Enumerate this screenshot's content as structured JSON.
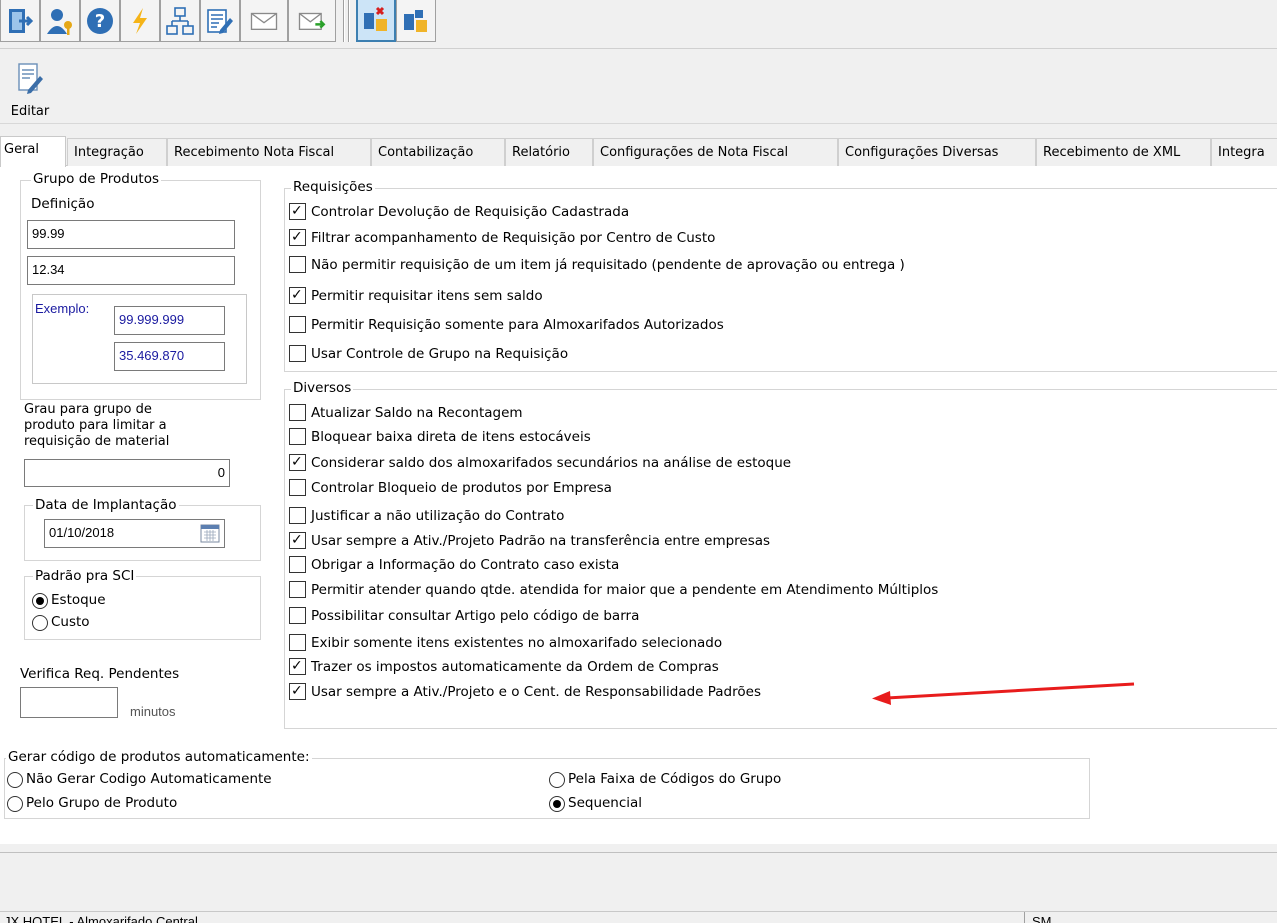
{
  "toolbar": {
    "icons": [
      "exit-icon",
      "user-key-icon",
      "help-icon",
      "lightning-icon",
      "org-chart-icon",
      "form-edit-icon",
      "mail-icon",
      "mail-send-icon",
      "module-close-icon",
      "module-icon"
    ]
  },
  "actions": {
    "edit_label": "Editar"
  },
  "tabs": [
    {
      "label": "Geral"
    },
    {
      "label": "Integração"
    },
    {
      "label": "Recebimento Nota Fiscal"
    },
    {
      "label": "Contabilização"
    },
    {
      "label": "Relatório"
    },
    {
      "label": "Configurações de Nota Fiscal"
    },
    {
      "label": "Configurações Diversas"
    },
    {
      "label": "Recebimento de XML"
    },
    {
      "label": "Integra"
    }
  ],
  "grupo_produtos": {
    "title": "Grupo de Produtos",
    "definicao_label": "Definição",
    "def1": "99.99",
    "def2": "12.34",
    "exemplo_label": "Exemplo:",
    "ex1": "99.999.999",
    "ex2": "35.469.870"
  },
  "grau": {
    "label_line1": "Grau para grupo de",
    "label_line2": "produto para limitar a",
    "label_line3": "requisição de material",
    "value": "0"
  },
  "data_implantacao": {
    "title": "Data de Implantação",
    "value": "01/10/2018"
  },
  "padrao_sci": {
    "title": "Padrão pra SCI",
    "options": [
      {
        "label": "Estoque",
        "selected": true
      },
      {
        "label": "Custo",
        "selected": false
      }
    ]
  },
  "verifica": {
    "label": "Verifica Req. Pendentes",
    "value": "",
    "unit": "minutos"
  },
  "requisicoes": {
    "title": "Requisições",
    "items": [
      {
        "label": "Controlar Devolução de Requisição Cadastrada",
        "checked": true
      },
      {
        "label": "Filtrar acompanhamento de Requisição por Centro de Custo",
        "checked": true
      },
      {
        "label": "Não permitir requisição de um item já requisitado (pendente de aprovação ou entrega )",
        "checked": false
      },
      {
        "label": "Permitir requisitar itens sem saldo",
        "checked": true
      },
      {
        "label": "Permitir Requisição somente para Almoxarifados Autorizados",
        "checked": false
      },
      {
        "label": "Usar Controle de Grupo na Requisição",
        "checked": false
      }
    ]
  },
  "diversos": {
    "title": "Diversos",
    "items": [
      {
        "label": "Atualizar Saldo na Recontagem",
        "checked": false
      },
      {
        "label": "Bloquear baixa direta de itens estocáveis",
        "checked": false
      },
      {
        "label": "Considerar saldo dos almoxarifados secundários na análise de estoque",
        "checked": true
      },
      {
        "label": "Controlar Bloqueio de produtos por Empresa",
        "checked": false
      },
      {
        "label": "Justificar a não utilização do Contrato",
        "checked": false
      },
      {
        "label": "Usar sempre a Ativ./Projeto Padrão na transferência entre empresas",
        "checked": true
      },
      {
        "label": "Obrigar a Informação do Contrato caso exista",
        "checked": false
      },
      {
        "label": "Permitir atender quando qtde. atendida for maior que a pendente em Atendimento Múltiplos",
        "checked": false
      },
      {
        "label": "Possibilitar consultar Artigo pelo código de barra",
        "checked": false
      },
      {
        "label": "Exibir somente itens existentes no almoxarifado selecionado",
        "checked": false
      },
      {
        "label": "Trazer os impostos automaticamente da Ordem de Compras",
        "checked": true
      },
      {
        "label": "Usar sempre a Ativ./Projeto e o Cent. de Responsabilidade Padrões",
        "checked": true
      }
    ]
  },
  "gerar_codigo": {
    "title": "Gerar código de produtos automaticamente:",
    "options": [
      {
        "label": "Não Gerar Codigo Automaticamente",
        "selected": false
      },
      {
        "label": "Pelo Grupo de Produto",
        "selected": false
      },
      {
        "label": "Pela Faixa de Códigos do Grupo",
        "selected": false
      },
      {
        "label": "Sequencial",
        "selected": true
      }
    ]
  },
  "annotation": {
    "color": "#e81c1c"
  },
  "statusbar": {
    "left": "JX HOTEL - Almoxarifado Central",
    "right": "SM"
  }
}
